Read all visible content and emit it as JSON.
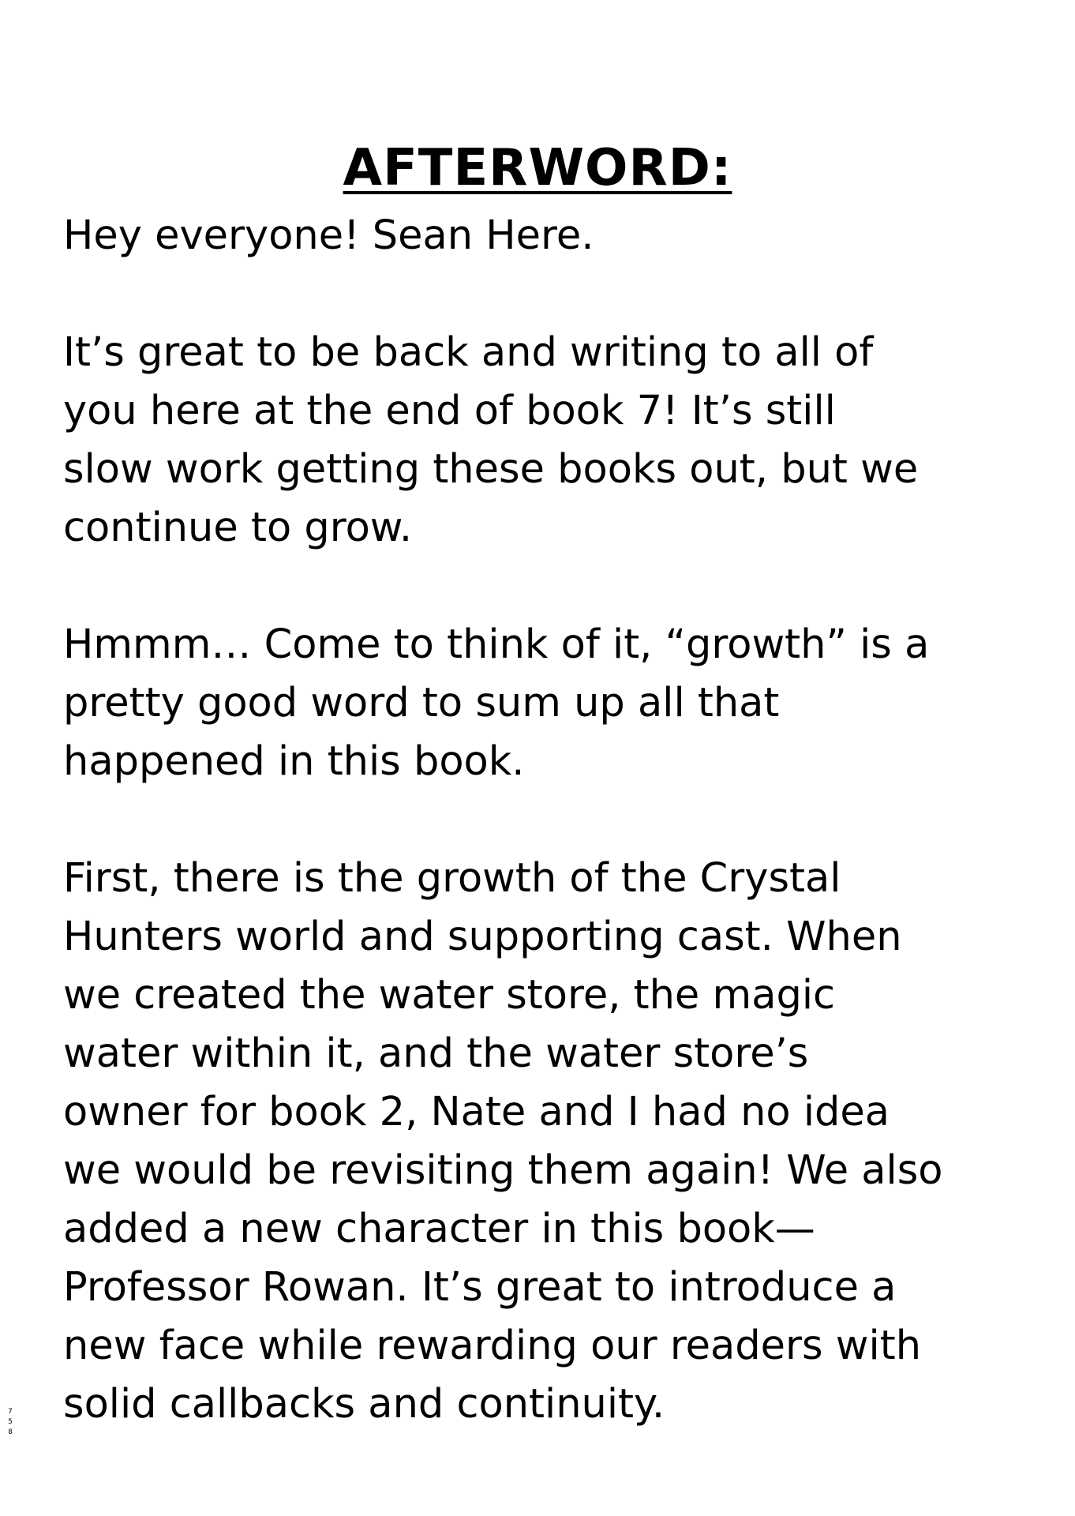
{
  "document": {
    "title": "AFTERWORD:",
    "paragraphs": [
      "Hey everyone! Sean Here.",
      "It’s great to be back and writing to all of\nyou here at the end of book 7! It’s still\nslow work getting these books out, but we\ncontinue to grow.",
      "Hmmm… Come to think of it, “growth” is a\npretty good word to sum up all that\nhappened in this book.",
      "First, there is the growth of the Crystal\nHunters world and supporting cast. When\nwe created the water store, the magic\nwater within it, and the water store’s\nowner for book 2, Nate and I had no idea\nwe would be revisiting them again! We also\nadded a new character in this book—\nProfessor Rowan. It’s great to introduce a\nnew face while rewarding our readers with\nsolid callbacks and continuity."
    ],
    "page_number": "7\n5\n8"
  }
}
